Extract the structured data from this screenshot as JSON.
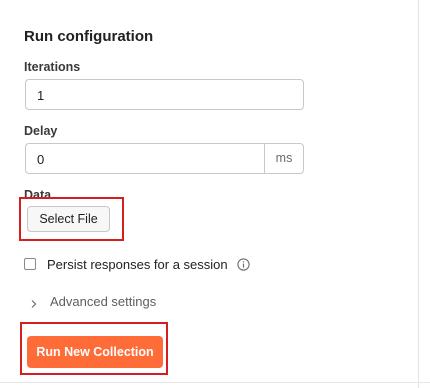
{
  "run_config": {
    "title": "Run configuration",
    "iterations": {
      "label": "Iterations",
      "value": "1"
    },
    "delay": {
      "label": "Delay",
      "value": "0",
      "unit": "ms"
    },
    "data": {
      "label": "Data",
      "select_file_label": "Select File"
    },
    "persist": {
      "label": "Persist responses for a session",
      "checked": false,
      "icon": "info-icon"
    },
    "advanced": {
      "label": "Advanced settings",
      "icon": "chevron-right-icon"
    },
    "run_button_label": "Run New Collection"
  },
  "colors": {
    "accent": "#ff6c37",
    "highlight_box": "#d51e1e"
  }
}
